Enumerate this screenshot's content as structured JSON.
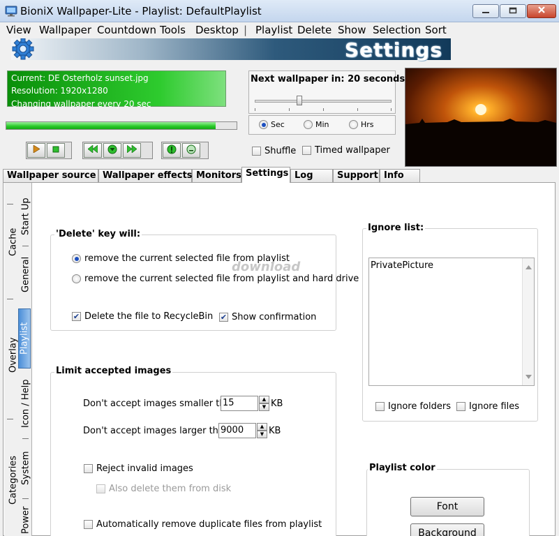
{
  "window": {
    "title": "BioniX Wallpaper-Lite - Playlist: DefaultPlaylist"
  },
  "menu": [
    {
      "label": "View"
    },
    {
      "label": "Wallpaper"
    },
    {
      "label": "Countdown"
    },
    {
      "label": "Tools"
    },
    {
      "label": "Desktop"
    },
    {
      "label": "|"
    },
    {
      "label": "Playlist"
    },
    {
      "label": "Delete"
    },
    {
      "label": "Show"
    },
    {
      "label": "Selection"
    },
    {
      "label": "Sort"
    }
  ],
  "banner": {
    "title": "Settings"
  },
  "status": {
    "current": "Current: DE Osterholz sunset.jpg",
    "resolution": "Resolution:  1920x1280",
    "interval": "Changing wallpaper every 20 sec"
  },
  "progress": {
    "fraction": 0.91
  },
  "next": {
    "label": "Next wallpaper in: 20 seconds",
    "slider_fraction": 0.33
  },
  "units": [
    {
      "label": "Sec",
      "checked": true
    },
    {
      "label": "Min",
      "checked": false
    },
    {
      "label": "Hrs",
      "checked": false
    }
  ],
  "options": {
    "shuffle": "Shuffle",
    "timed": "Timed wallpaper"
  },
  "tabs": [
    {
      "label": "Wallpaper source"
    },
    {
      "label": "Wallpaper effects"
    },
    {
      "label": "Monitors"
    },
    {
      "label": "Settings"
    },
    {
      "label": "Log"
    },
    {
      "label": "Support"
    },
    {
      "label": "Info"
    }
  ],
  "side_tabs": {
    "cache": "Cache",
    "startup": "Start Up",
    "general": "General",
    "overlay": "Overlay",
    "playlist": "Playlist",
    "iconhelp": "Icon / Help",
    "categories": "Categories",
    "system": "System",
    "power": "Power"
  },
  "delete_key": {
    "title": "'Delete' key will:",
    "opt1": "remove the current selected file from playlist",
    "opt2": "remove the current selected file from playlist and hard drive",
    "recycle": "Delete the file to RecycleBin",
    "confirm": "Show confirmation"
  },
  "limits": {
    "title": "Limit accepted images",
    "smaller_label": "Don't accept images smaller than",
    "smaller_value": "15",
    "larger_label": "Don't accept images larger than",
    "larger_value": "9000",
    "unit": "KB",
    "reject": "Reject invalid images",
    "also_delete": "Also delete them from disk",
    "dupes": "Automatically remove duplicate files from playlist"
  },
  "ignore": {
    "title": "Ignore list:",
    "items": [
      "PrivatePicture"
    ],
    "folders": "Ignore folders",
    "files": "Ignore files"
  },
  "playlist_color": {
    "title": "Playlist color",
    "font_btn": "Font",
    "bg_btn": "Background"
  },
  "watermark": "download"
}
